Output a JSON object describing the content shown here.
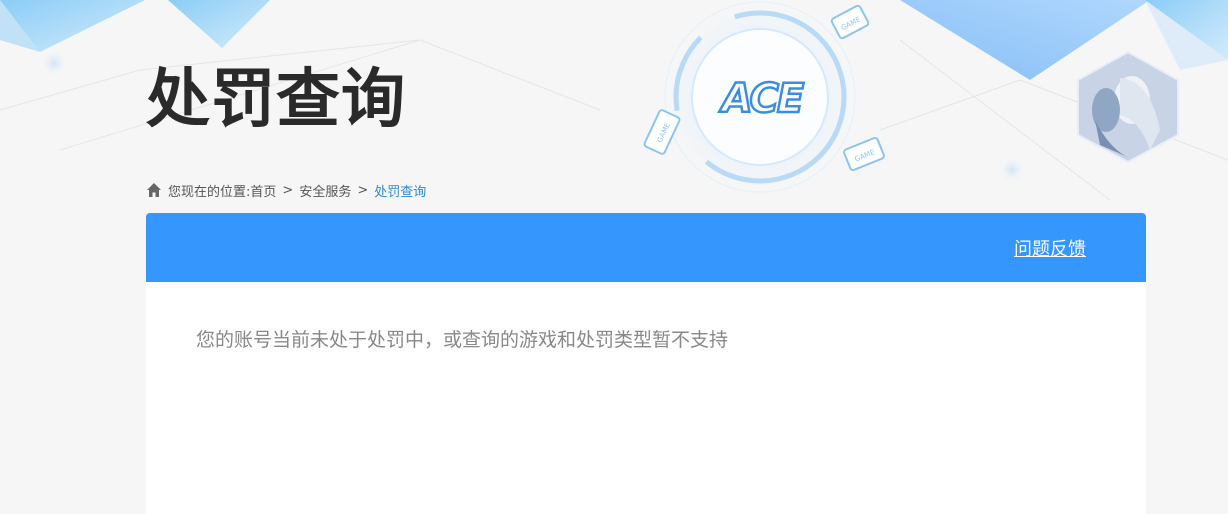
{
  "page": {
    "title": "处罚查询",
    "logo_text": "ACE",
    "badge_text": "GAME"
  },
  "breadcrumb": {
    "prefix": "您现在的位置:",
    "items": [
      "首页",
      "安全服务",
      "处罚查询"
    ],
    "separator": ">"
  },
  "panel": {
    "feedback_label": "问题反馈",
    "message": "您的账号当前未处于处罚中，或查询的游戏和处罚类型暂不支持"
  },
  "colors": {
    "header_blue": "#3596fd",
    "current_link": "#2a8ad8",
    "title_text": "#2a2a2a",
    "message_text": "#888888"
  },
  "icons": {
    "home": "home-icon",
    "logo": "ace-logo-icon",
    "game_badge": "game-badge-icon",
    "avatar": "hexagon-character-avatar"
  }
}
